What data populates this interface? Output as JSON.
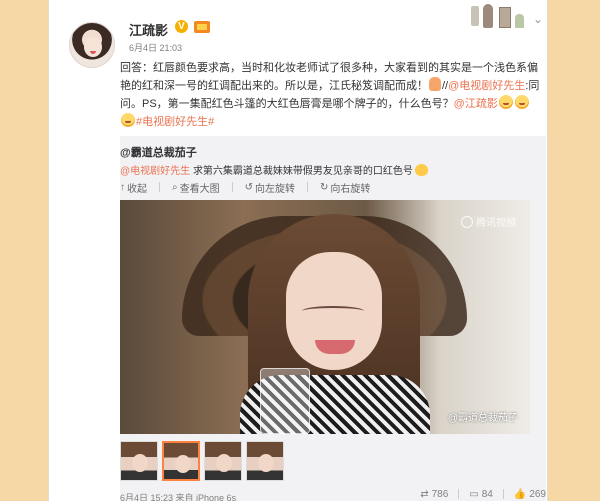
{
  "post": {
    "username": "江疏影",
    "verified_badge": "V",
    "timestamp": "6月4日 21:03",
    "text": {
      "p1": "回答：红唇颜色要求高，当时和化妆老师试了很多种，大家看到的其实是一个浅色系偏艳的红和深一号的红调配出来的。所以是，江氏秘笈调配而成！",
      "sep1": "//",
      "mention1": "@电视剧好先生",
      "p2": ":同问。PS，第一集配红色斗篷的大红色唇膏是哪个牌子的，什么色号？",
      "mention2": "@江疏影",
      "hashtag": "#电视剧好先生#"
    }
  },
  "repost": {
    "author": "@霸道总裁茄子",
    "mention": "@电视剧好先生",
    "text": "求第六集霸道总裁妹妹带假男友见亲哥的口红色号",
    "toolbar": {
      "collect": "收起",
      "view_large": "查看大图",
      "rotate_left": "向左旋转",
      "rotate_right": "向右旋转"
    },
    "image": {
      "watermark_top": "腾讯视频",
      "watermark_bottom": "@霸道总裁茄子"
    },
    "footer": {
      "time_source": "6月4日 15:23 来自 iPhone 6s",
      "reposts": "786",
      "comments": "84",
      "likes": "269"
    }
  },
  "icons": {
    "verified": "verified-v-icon",
    "member": "member-crown-icon",
    "collapse": "chevron-down-icon"
  },
  "colors": {
    "link": "#eb7350",
    "background": "#f5d8a6",
    "repost_bg": "#f2f2f5",
    "active_thumb": "#ff8140"
  }
}
